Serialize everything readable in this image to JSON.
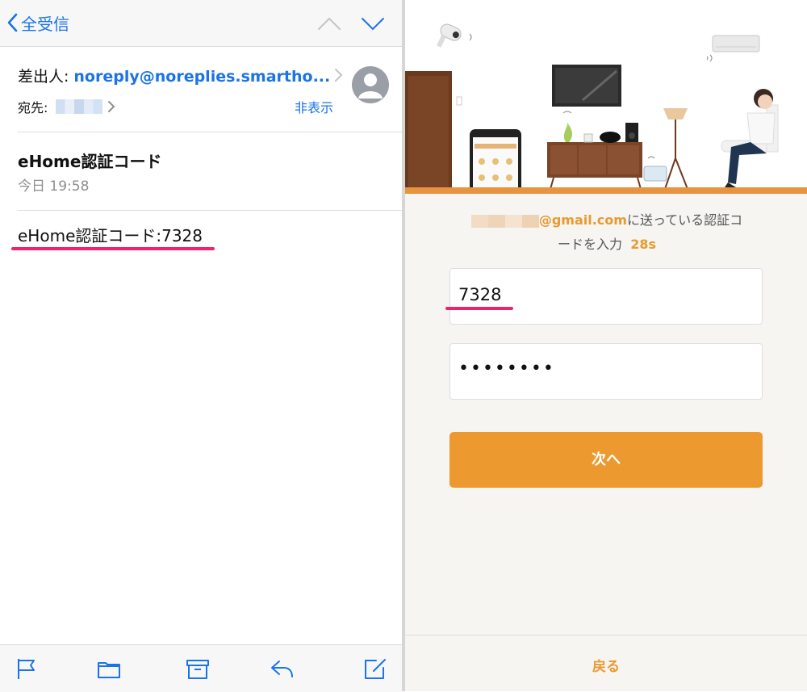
{
  "mail": {
    "nav": {
      "back_label": "全受信"
    },
    "header": {
      "from_label": "差出人:",
      "from_address": "noreply@noreplies.smartho...",
      "to_label": "宛先:",
      "hide_label": "非表示"
    },
    "subject": "eHome認証コード",
    "date": "今日 19:58",
    "body": "eHome認証コード:7328",
    "toolbar": [
      "flag-icon",
      "folder-icon",
      "archive-icon",
      "reply-icon",
      "compose-icon"
    ]
  },
  "app": {
    "hint": {
      "email_domain": "@gmail.com",
      "text_1": "に送っている認証コ",
      "text_2": "ードを入力",
      "countdown": "28s"
    },
    "code_value": "7328",
    "password_value": "••••••••",
    "next_button": "次へ",
    "back_link": "戻る"
  },
  "colors": {
    "ios_blue": "#1a73e8",
    "accent_orange": "#ec9a2f",
    "highlight_pink": "#f0226f"
  }
}
